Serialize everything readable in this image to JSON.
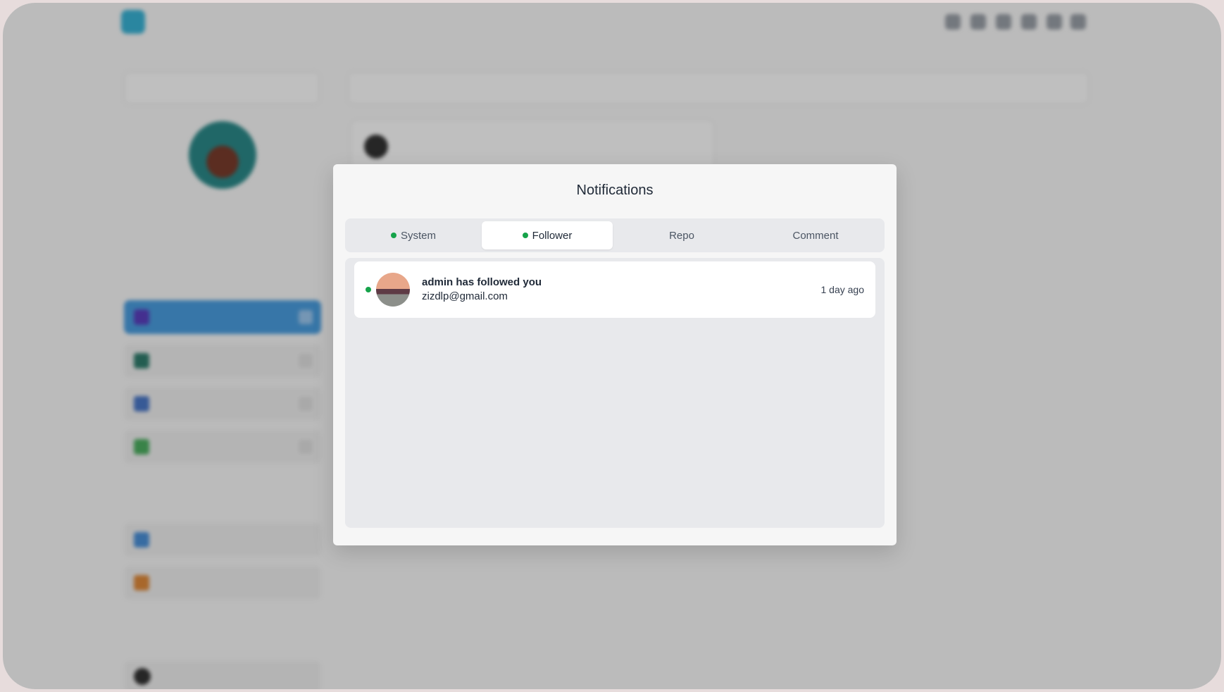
{
  "modal": {
    "title": "Notifications",
    "tabs": [
      {
        "label": "System",
        "unread": true
      },
      {
        "label": "Follower",
        "unread": true
      },
      {
        "label": "Repo",
        "unread": false
      },
      {
        "label": "Comment",
        "unread": false
      }
    ],
    "active_tab": "Follower",
    "notifications": [
      {
        "message": "admin has followed you",
        "email": "zizdlp@gmail.com",
        "time": "1 day ago",
        "unread": true
      }
    ]
  },
  "colors": {
    "unread_dot": "#16a34a",
    "overlay": "rgba(0,0,0,0.25)"
  }
}
